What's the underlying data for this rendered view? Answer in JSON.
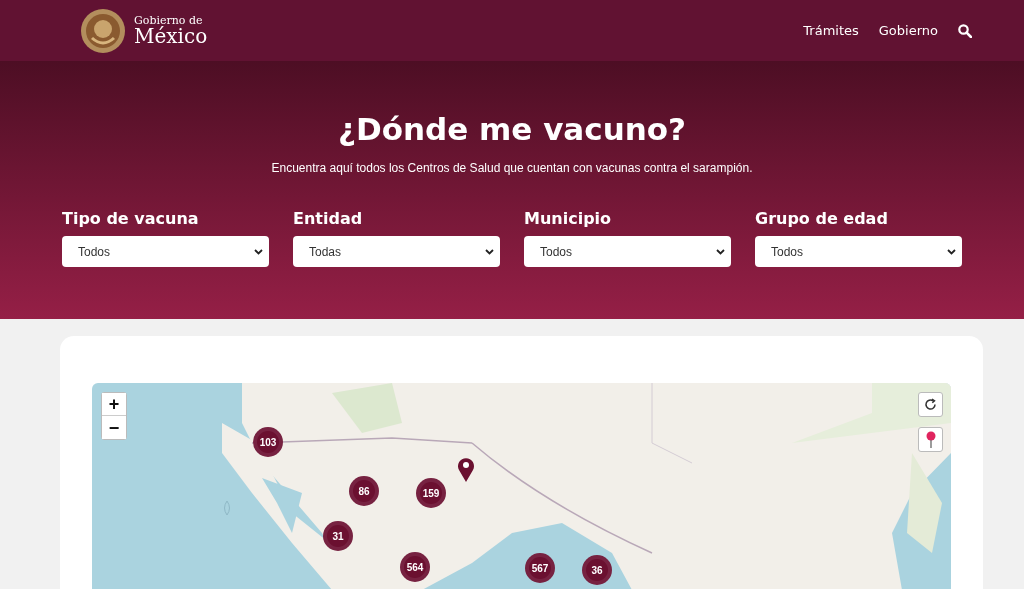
{
  "header": {
    "logo_top": "Gobierno de",
    "logo_bottom": "México",
    "nav": [
      "Trámites",
      "Gobierno"
    ]
  },
  "hero": {
    "title": "¿Dónde me vacuno?",
    "subtitle": "Encuentra aquí todos los Centros de Salud que cuentan con vacunas contra el sarampión.",
    "filters": [
      {
        "label": "Tipo de vacuna",
        "value": "Todos"
      },
      {
        "label": "Entidad",
        "value": "Todas"
      },
      {
        "label": "Municipio",
        "value": "Todos"
      },
      {
        "label": "Grupo de edad",
        "value": "Todos"
      }
    ]
  },
  "map": {
    "zoom_in": "+",
    "zoom_out": "−",
    "clusters": [
      "103",
      "86",
      "159",
      "31",
      "564",
      "567",
      "36"
    ]
  }
}
